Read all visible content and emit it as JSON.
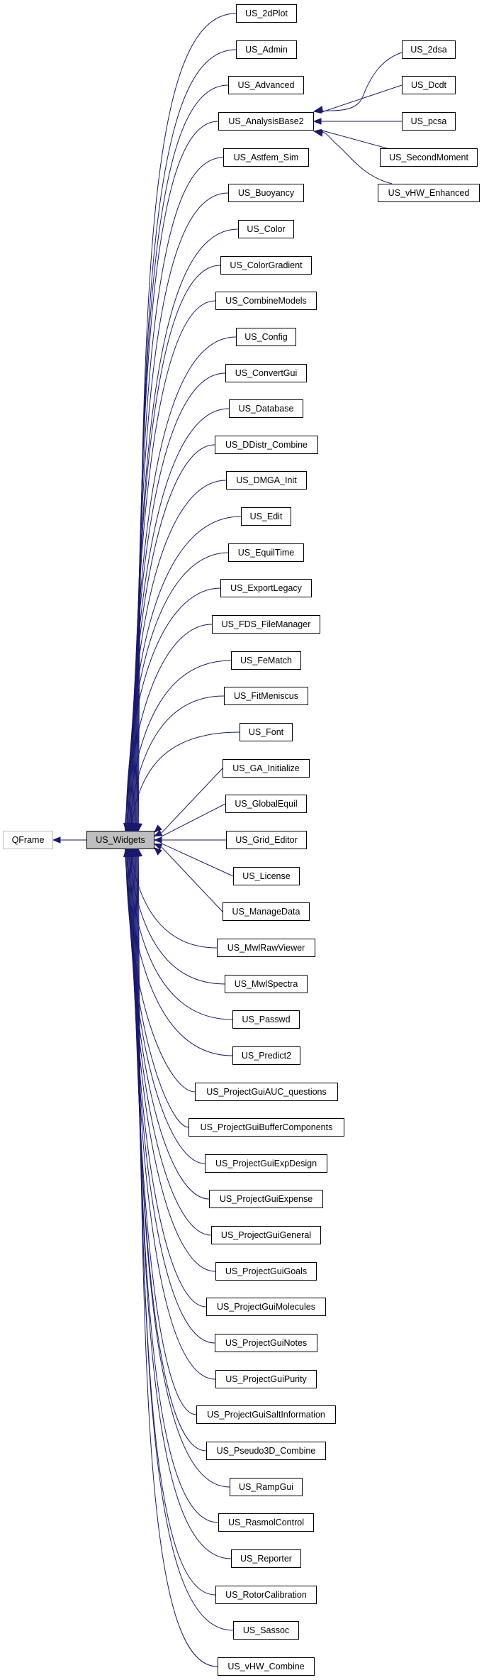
{
  "diagram": {
    "type": "inheritance-graph",
    "colors": {
      "edge": "#191970",
      "node_border": "#000000",
      "external_border": "#bfbfbf",
      "current_fill": "#bfbfbf",
      "text": "#000000"
    },
    "base": {
      "id": "QFrame",
      "label": "QFrame",
      "external": true
    },
    "current": {
      "id": "US_Widgets",
      "label": "US_Widgets"
    },
    "derived": [
      "US_2dPlot",
      "US_Admin",
      "US_Advanced",
      "US_AnalysisBase2",
      "US_Astfem_Sim",
      "US_Buoyancy",
      "US_Color",
      "US_ColorGradient",
      "US_CombineModels",
      "US_Config",
      "US_ConvertGui",
      "US_Database",
      "US_DDistr_Combine",
      "US_DMGA_Init",
      "US_Edit",
      "US_EquilTime",
      "US_ExportLegacy",
      "US_FDS_FileManager",
      "US_FeMatch",
      "US_FitMeniscus",
      "US_Font",
      "US_GA_Initialize",
      "US_GlobalEquil",
      "US_Grid_Editor",
      "US_License",
      "US_ManageData",
      "US_MwlRawViewer",
      "US_MwlSpectra",
      "US_Passwd",
      "US_Predict2",
      "US_ProjectGuiAUC_questions",
      "US_ProjectGuiBufferComponents",
      "US_ProjectGuiExpDesign",
      "US_ProjectGuiExpense",
      "US_ProjectGuiGeneral",
      "US_ProjectGuiGoals",
      "US_ProjectGuiMolecules",
      "US_ProjectGuiNotes",
      "US_ProjectGuiPurity",
      "US_ProjectGuiSaltInformation",
      "US_Pseudo3D_Combine",
      "US_RampGui",
      "US_RasmolControl",
      "US_Reporter",
      "US_RotorCalibration",
      "US_Sassoc",
      "US_vHW_Combine"
    ],
    "analysis_base": {
      "id": "US_AnalysisBase2",
      "derived": [
        "US_2dsa",
        "US_Dcdt",
        "US_pcsa",
        "US_SecondMoment",
        "US_vHW_Enhanced"
      ]
    },
    "edges": [
      {
        "from": "US_Widgets",
        "to": "QFrame",
        "relation": "inherits"
      }
    ]
  }
}
